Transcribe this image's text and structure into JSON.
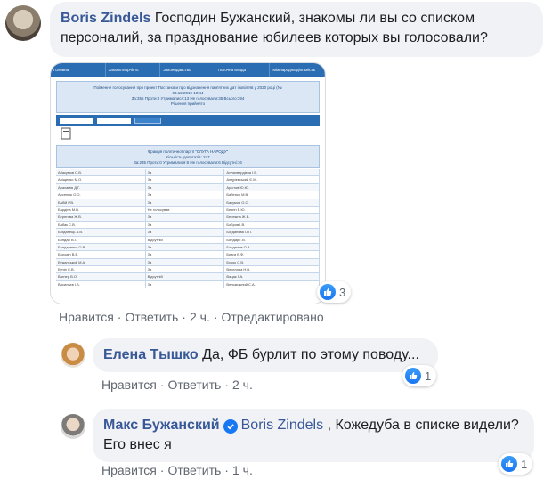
{
  "comments": [
    {
      "author": "Boris Zindels",
      "text": "Господин Бужанский, знакомы ли вы со списком персоналий, за празднование юбилеев которых вы голосовали?",
      "actions": [
        "Нравится",
        "Ответить",
        "2 ч.",
        "Отредактировано"
      ],
      "reaction_count": "3",
      "attachment": {
        "nav": [
          "Головна",
          "Законотворчість",
          "Законодавство",
          "Поточна влада",
          "Міжнародна діяльність"
        ],
        "header_lines": [
          "Поіменне голосування про проект Постанови про відзначення пам'ятних дат і ювілеїв у 2020 році (№",
          "03.12.2019 10:44",
          "За:355 Проти:0 Утрималися:13 Не голосували:35 Всього:394",
          "Рішення прийнято"
        ],
        "fraction_lines": [
          "Фракція політичної партії \"СЛУГА НАРОДУ\"",
          "Кількість депутатів: 247",
          "За:235 Проти:0 Утрималися:6 Не голосували:6 Відсутні:16"
        ],
        "rows": [
          [
            "Абакумов О.В.",
            "За",
            "Аллахвердієва І.В."
          ],
          [
            "Аніщенко М.О.",
            "За",
            "Андрієвський Є.М."
          ],
          [
            "Арахамія Д.Г.",
            "За",
            "Арістов Ю.Ю."
          ],
          [
            "Арсенюк О.О.",
            "За",
            "Бабенко М.В."
          ],
          [
            "Бабій Р.В.",
            "За",
            "Бакумов О.С."
          ],
          [
            "Бардіна М.В.",
            "Не голосував",
            "Безгін В.Ю."
          ],
          [
            "Берегова Ж.В.",
            "За",
            "Бережна Ж.В."
          ],
          [
            "Бабак С.В.",
            "За",
            "Бобров І.В."
          ],
          [
            "Богданець А.В.",
            "За",
            "Богданова О.П."
          ],
          [
            "Бондар В.І.",
            "Відсутній",
            "Бондар Г.В."
          ],
          [
            "Бондаренко О.В.",
            "За",
            "Бордюгов О.В."
          ],
          [
            "Бородін В.В.",
            "За",
            "Браги В.Ф."
          ],
          [
            "Бужанський М.А.",
            "За",
            "Бучок О.В."
          ],
          [
            "Бунін С.В.",
            "За",
            "Веселова Н.В."
          ],
          [
            "Вагнер В.О.",
            "Відсутній",
            "Вацак Г.А."
          ],
          [
            "Васильєв І.В.",
            "За",
            "Вельможний С.А."
          ]
        ]
      }
    },
    {
      "author": "Елена Тышко",
      "text": "Да, ФБ бурлит по этому поводу...",
      "actions": [
        "Нравится",
        "Ответить",
        "2 ч."
      ],
      "reaction_count": "1"
    },
    {
      "author": "Макс Бужанский",
      "mention": "Boris Zindels",
      "text": ", Кожедуба в списке видели? Его внес я",
      "actions": [
        "Нравится",
        "Ответить",
        "1 ч."
      ],
      "reaction_count": "1"
    }
  ],
  "colors": {
    "link": "#385898",
    "bubble": "#f0f2f5",
    "like": "#1877f2",
    "meta": "#606770"
  }
}
